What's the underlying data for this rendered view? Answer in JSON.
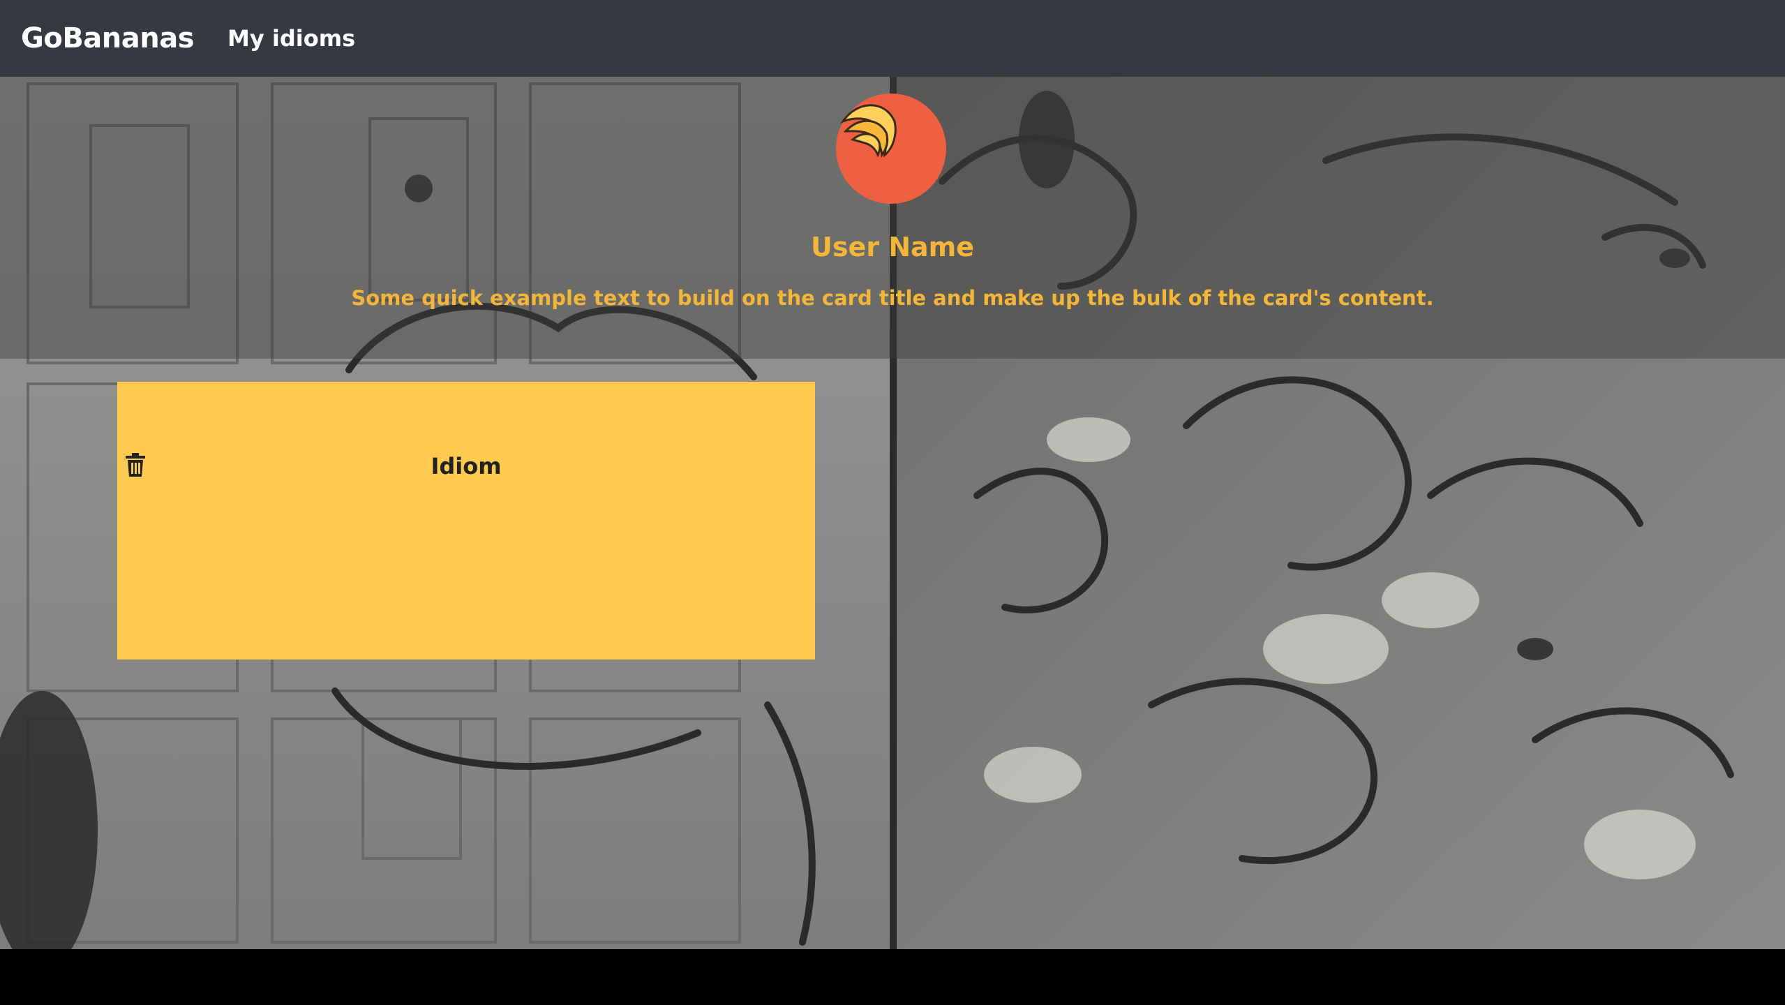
{
  "navbar": {
    "brand": "GoBananas",
    "links": [
      {
        "label": "My idioms"
      }
    ]
  },
  "profile": {
    "avatar_icon": "banana-logo-icon",
    "name": "User Name",
    "text": "Some quick example text to build on the card title and make up the bulk of the card's content."
  },
  "idioms": [
    {
      "label": "Idiom",
      "delete_icon": "trash-icon"
    }
  ],
  "colors": {
    "navbar": "#343a40",
    "accent": "#f4b63a",
    "avatar": "#ef6042",
    "card": "#fdc94f"
  }
}
